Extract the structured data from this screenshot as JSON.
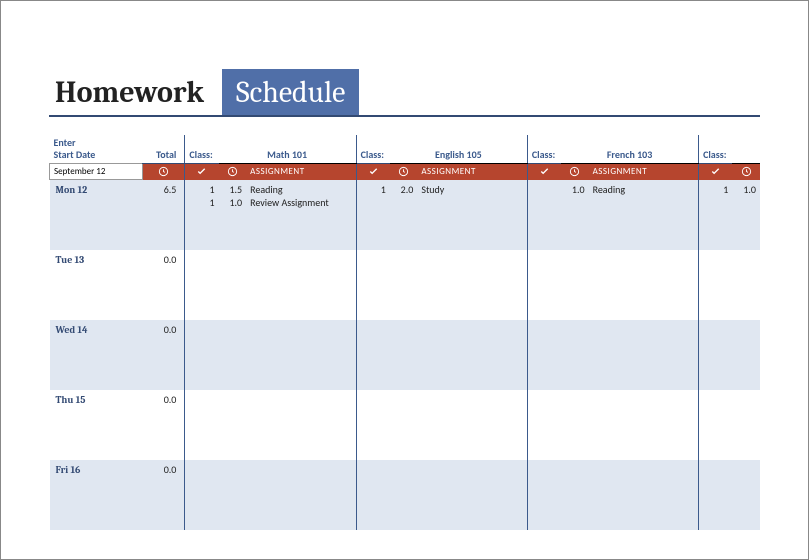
{
  "title": {
    "left": "Homework",
    "right": "Schedule"
  },
  "labels": {
    "enter_start_date": "Enter\nStart Date",
    "total": "Total",
    "class": "Class:",
    "assignment": "ASSIGNMENT"
  },
  "start_date": "September 12",
  "classes": [
    {
      "name": "Math 101"
    },
    {
      "name": "English 105"
    },
    {
      "name": "French 103"
    },
    {
      "name": ""
    }
  ],
  "days": [
    {
      "label": "Mon 12",
      "total": "6.5",
      "alt": true,
      "cells": [
        {
          "rows": [
            {
              "check": "1",
              "hrs": "1.5",
              "txt": "Reading"
            },
            {
              "check": "1",
              "hrs": "1.0",
              "txt": "Review Assignment"
            }
          ]
        },
        {
          "rows": [
            {
              "check": "1",
              "hrs": "2.0",
              "txt": "Study"
            }
          ]
        },
        {
          "rows": [
            {
              "check": "",
              "hrs": "1.0",
              "txt": "Reading"
            }
          ]
        },
        {
          "rows": [
            {
              "check": "1",
              "hrs": "1.0",
              "txt": ""
            }
          ]
        }
      ]
    },
    {
      "label": "Tue 13",
      "total": "0.0",
      "alt": false,
      "cells": [
        {
          "rows": []
        },
        {
          "rows": []
        },
        {
          "rows": []
        },
        {
          "rows": []
        }
      ]
    },
    {
      "label": "Wed 14",
      "total": "0.0",
      "alt": true,
      "cells": [
        {
          "rows": []
        },
        {
          "rows": []
        },
        {
          "rows": []
        },
        {
          "rows": []
        }
      ]
    },
    {
      "label": "Thu 15",
      "total": "0.0",
      "alt": false,
      "cells": [
        {
          "rows": []
        },
        {
          "rows": []
        },
        {
          "rows": []
        },
        {
          "rows": []
        }
      ]
    },
    {
      "label": "Fri 16",
      "total": "0.0",
      "alt": true,
      "cells": [
        {
          "rows": []
        },
        {
          "rows": []
        },
        {
          "rows": []
        },
        {
          "rows": []
        }
      ]
    }
  ]
}
